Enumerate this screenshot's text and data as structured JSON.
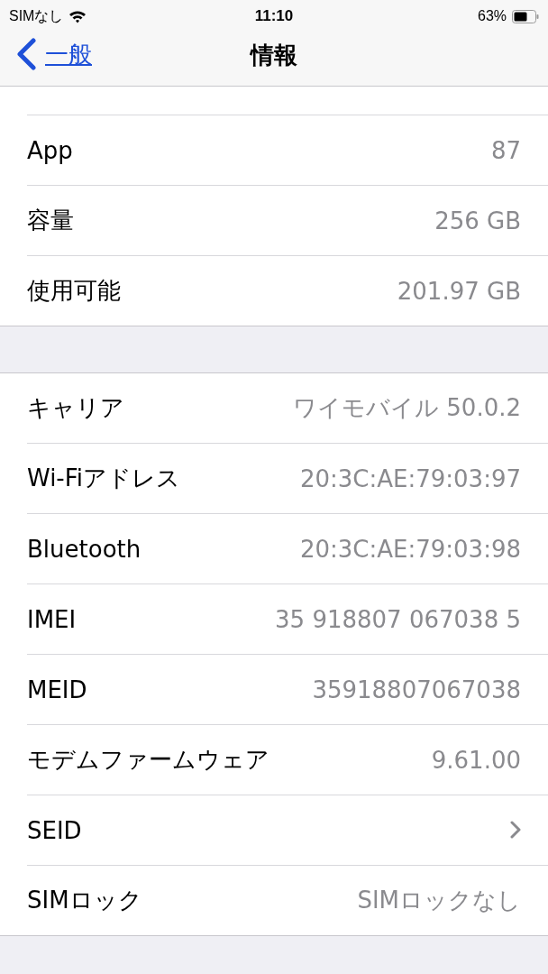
{
  "status_bar": {
    "carrier": "SIMなし",
    "time": "11:10",
    "battery": "63%"
  },
  "nav": {
    "back": "一般",
    "title": "情報"
  },
  "groups": [
    {
      "rows": [
        {
          "label": "App",
          "value": "87",
          "kind": "value"
        },
        {
          "label": "容量",
          "value": "256 GB",
          "kind": "value"
        },
        {
          "label": "使用可能",
          "value": "201.97 GB",
          "kind": "value"
        }
      ]
    },
    {
      "rows": [
        {
          "label": "キャリア",
          "value": "ワイモバイル 50.0.2",
          "kind": "value"
        },
        {
          "label": "Wi-Fiアドレス",
          "value": "20:3C:AE:79:03:97",
          "kind": "value"
        },
        {
          "label": "Bluetooth",
          "value": "20:3C:AE:79:03:98",
          "kind": "value"
        },
        {
          "label": "IMEI",
          "value": "35 918807 067038 5",
          "kind": "value"
        },
        {
          "label": "MEID",
          "value": "35918807067038",
          "kind": "value"
        },
        {
          "label": "モデムファームウェア",
          "value": "9.61.00",
          "kind": "value"
        },
        {
          "label": "SEID",
          "kind": "link"
        },
        {
          "label": "SIMロック",
          "value": "SIMロックなし",
          "kind": "value"
        }
      ]
    }
  ]
}
